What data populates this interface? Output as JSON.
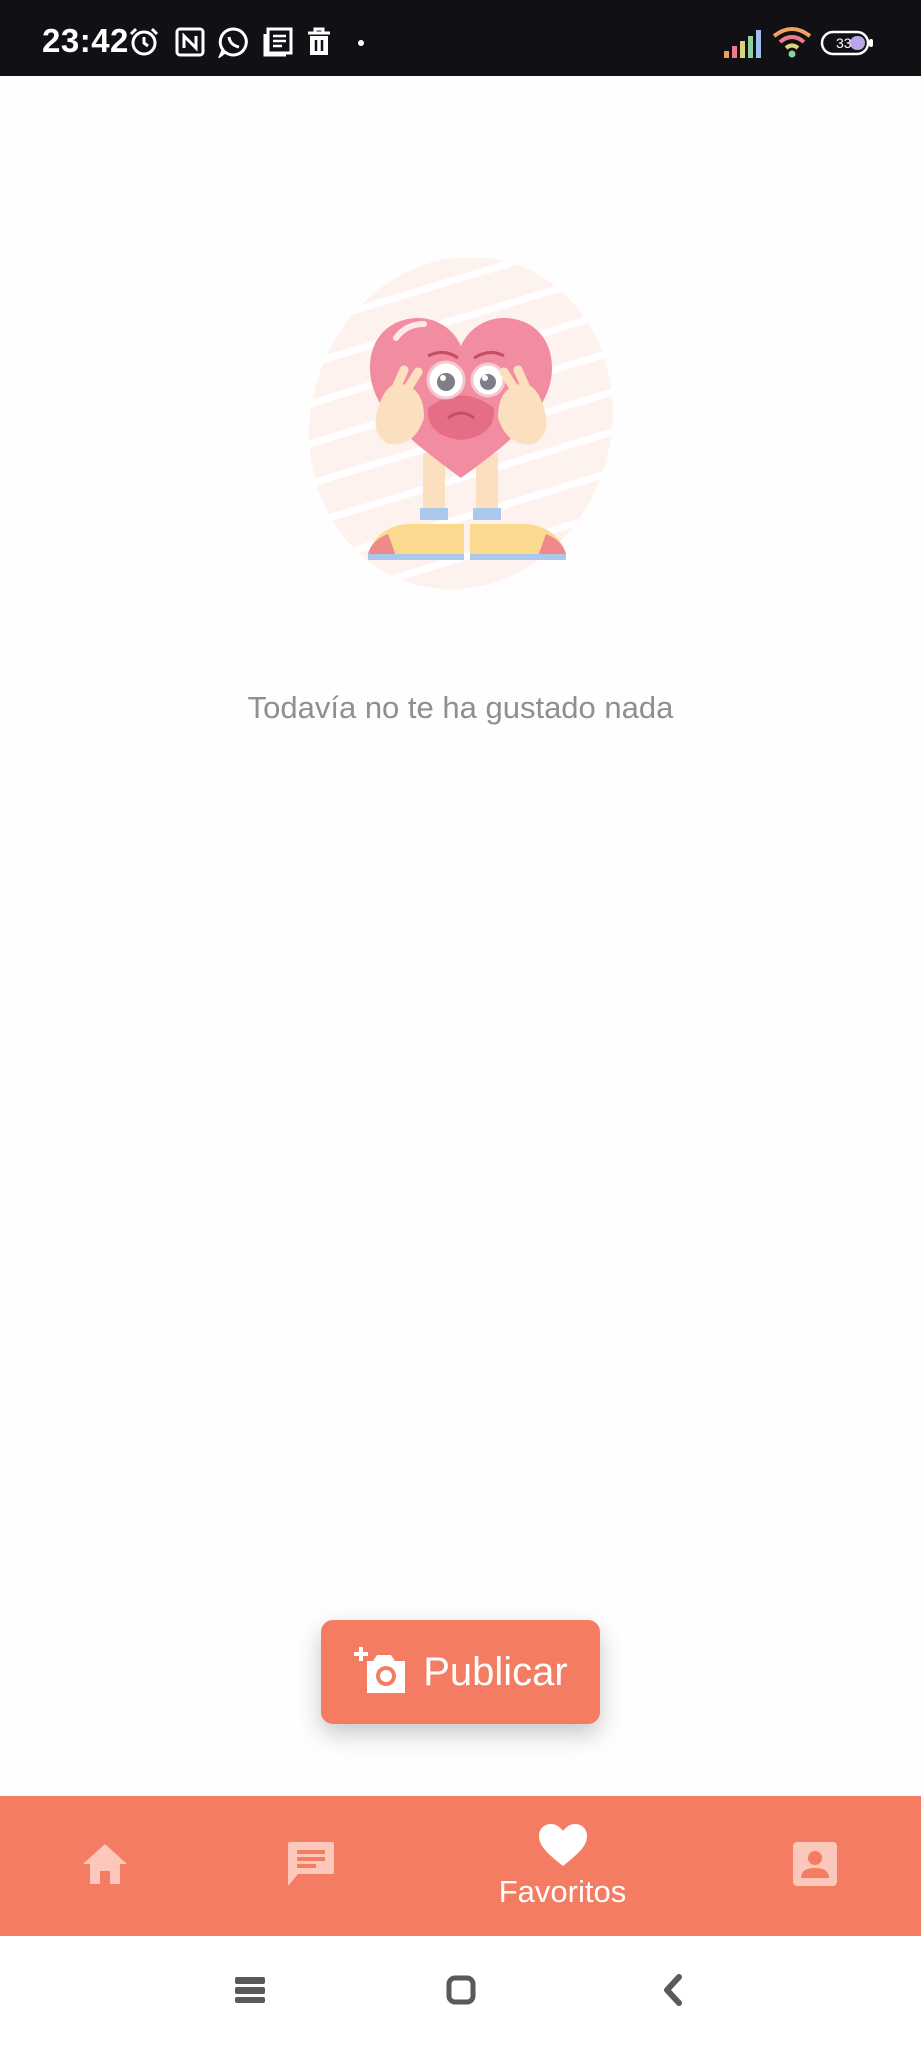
{
  "status_bar": {
    "time": "23:42",
    "battery": "33",
    "icons": [
      "alarm-icon",
      "nfc-icon",
      "whatsapp-icon",
      "news-icon",
      "trash-icon",
      "signal-icon",
      "wifi-icon",
      "battery-icon"
    ]
  },
  "empty_state": {
    "message": "Todavía no te ha gustado nada",
    "illustration": "sad-heart-illustration"
  },
  "fab": {
    "label": "Publicar",
    "icon": "add-photo-icon"
  },
  "bottom_nav": {
    "items": [
      {
        "icon": "home-icon",
        "label": ""
      },
      {
        "icon": "chat-icon",
        "label": ""
      },
      {
        "icon": "heart-icon",
        "label": "Favoritos",
        "active": true
      },
      {
        "icon": "profile-icon",
        "label": ""
      }
    ]
  },
  "system_nav": {
    "buttons": [
      "recents-icon",
      "home-square-icon",
      "back-icon"
    ]
  },
  "colors": {
    "accent": "#f47c62",
    "status_bar": "#111015",
    "empty_text": "#8f8f8f"
  }
}
